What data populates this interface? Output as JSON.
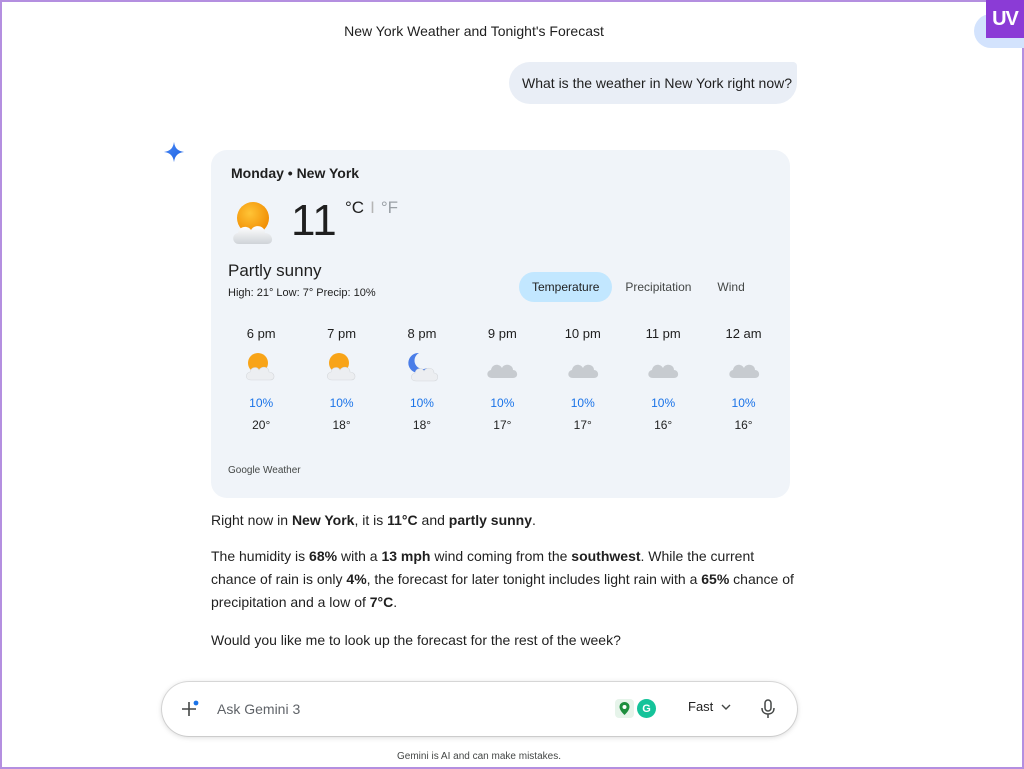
{
  "conversation": {
    "title": "New York Weather and Tonight's Forecast"
  },
  "brand": {
    "corner_logo": "UV"
  },
  "user_message": {
    "text": "What is the weather in New York right now?"
  },
  "weather": {
    "day_location": "Monday • New York",
    "current_temp": "11",
    "unit_c": "°C",
    "unit_sep": "I",
    "unit_f": "°F",
    "condition": "Partly sunny",
    "hilo": "High: 21°  Low: 7°  Precip: 10%",
    "tabs": [
      {
        "label": "Temperature",
        "active": true
      },
      {
        "label": "Precipitation",
        "active": false
      },
      {
        "label": "Wind",
        "active": false
      }
    ],
    "hourly": [
      {
        "hour": "6 pm",
        "icon": "partly-sunny-icon",
        "precip": "10%",
        "temp": "20°"
      },
      {
        "hour": "7 pm",
        "icon": "partly-sunny-icon",
        "precip": "10%",
        "temp": "18°"
      },
      {
        "hour": "8 pm",
        "icon": "partly-cloudy-night-icon",
        "precip": "10%",
        "temp": "18°"
      },
      {
        "hour": "9 pm",
        "icon": "cloudy-icon",
        "precip": "10%",
        "temp": "17°"
      },
      {
        "hour": "10 pm",
        "icon": "cloudy-icon",
        "precip": "10%",
        "temp": "17°"
      },
      {
        "hour": "11 pm",
        "icon": "cloudy-icon",
        "precip": "10%",
        "temp": "16°"
      },
      {
        "hour": "12 am",
        "icon": "cloudy-icon",
        "precip": "10%",
        "temp": "16°"
      }
    ],
    "source": "Google Weather"
  },
  "answer": {
    "p1": {
      "t1": "Right now in ",
      "b1": "New York",
      "t2": ", it is ",
      "b2": "11°C",
      "t3": " and ",
      "b3": "partly sunny",
      "t4": "."
    },
    "p2": {
      "t1": "The humidity is ",
      "b1": "68%",
      "t2": " with a ",
      "b2": "13 mph",
      "t3": " wind coming from the ",
      "b3": "southwest",
      "t4": ". While the current chance of rain is only ",
      "b4": "4%",
      "t5": ", the forecast for later tonight includes light rain with a ",
      "b5": "65%",
      "t6": " chance of precipitation and a low of ",
      "b6": "7°C",
      "t7": "."
    },
    "p3": {
      "text": "Would you like me to look up the forecast for the rest of the week?"
    }
  },
  "input": {
    "placeholder": "Ask Gemini 3",
    "ext2_label": "G",
    "mode_label": "Fast"
  },
  "footer": {
    "disclaimer": "Gemini is AI and can make mistakes."
  },
  "colors": {
    "accent_blue": "#1a73e8",
    "active_tab": "#c2e7ff",
    "card_bg": "#f0f4f9",
    "user_bubble": "#e9eef6",
    "logo_purple": "#8b3bd6"
  }
}
